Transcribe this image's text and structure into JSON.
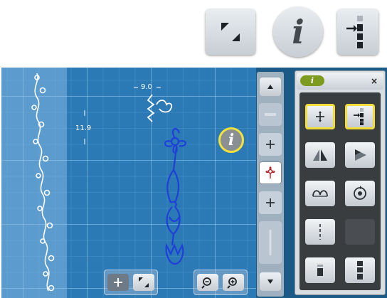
{
  "top_toolbar": {
    "icons": [
      "resize-icon",
      "info-icon",
      "move-stitch-icon"
    ],
    "info_glyph": "i"
  },
  "stitch_view": {
    "width_value": "9.0",
    "height_value": "11.9",
    "info_glyph": "i"
  },
  "bottom_controls": {
    "move_icon": "move-icon",
    "resize_icon": "resize-icon",
    "zoom_out_icon": "zoom-out-icon",
    "zoom_in_icon": "zoom-in-icon"
  },
  "scroll_strip": {
    "up_icon": "arrow-up-icon",
    "down_icon": "arrow-down-icon"
  },
  "panel": {
    "info_glyph": "i",
    "close_glyph": "×"
  },
  "colors": {
    "screen_bg": "#2b7ab6",
    "highlight": "#f0dd3a",
    "stitch_blue": "#1f3fd8",
    "panel_bg": "#d8dde2",
    "info_green": "#7d9b1e"
  }
}
